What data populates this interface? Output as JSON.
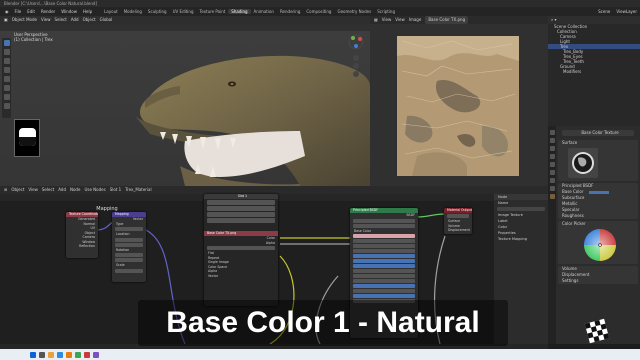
{
  "window": {
    "title": "Blender [C:\\Users\\...\\Base Color Natural.blend]"
  },
  "menubar": {
    "items": [
      "File",
      "Edit",
      "Render",
      "Window",
      "Help"
    ],
    "workspaces": [
      "Layout",
      "Modeling",
      "Sculpting",
      "UV Editing",
      "Texture Paint",
      "Shading",
      "Animation",
      "Rendering",
      "Compositing",
      "Geometry Nodes",
      "Scripting"
    ],
    "active_workspace": "Shading",
    "scene": "Scene",
    "view_layer": "ViewLayer"
  },
  "viewport": {
    "mode": "Object Mode",
    "menus": [
      "View",
      "Select",
      "Add",
      "Object"
    ],
    "transform": "Global",
    "perspective_label": "User Perspective",
    "collection_label": "(1) Collection | Trex"
  },
  "image_editor": {
    "menus": [
      "View",
      "View",
      "Image"
    ],
    "image_name": "Base Color TX.png"
  },
  "outliner": {
    "rows": [
      "Scene Collection",
      "Collection",
      "Camera",
      "Light",
      "Trex",
      "Trex_Body",
      "Trex_Eyes",
      "Trex_Teeth",
      "Ground",
      "Modifiers"
    ],
    "selected_index": 4
  },
  "properties": {
    "header": "Base Color Texture",
    "sections": [
      "Surface",
      "Volume",
      "Displacement",
      "Settings"
    ],
    "rows": [
      "Surface",
      "Principled BSDF",
      "Base Color",
      "Subsurface",
      "Metallic",
      "Specular",
      "Roughness",
      "Color Picker"
    ],
    "accent": "#7a5d3f"
  },
  "shader_editor": {
    "menus": [
      "Object",
      "View",
      "Select",
      "Add",
      "Node"
    ],
    "use_nodes_label": "Use Nodes",
    "slot_label": "Slot 1",
    "material_label": "Trex_Material",
    "frame_label": "Mapping",
    "nodes": {
      "texcoord": {
        "title": "Texture Coordinate",
        "rows": [
          "Generated",
          "Normal",
          "UV",
          "Object",
          "Camera",
          "Window",
          "Reflection"
        ]
      },
      "mapping": {
        "title": "Mapping",
        "rows": [
          "Vector",
          "Type",
          "Point",
          "Location",
          "Rotation",
          "Scale"
        ]
      },
      "image": {
        "title": "Base Color TX.png",
        "rows": [
          "Color",
          "Alpha",
          "Linear",
          "Flat",
          "Repeat",
          "Single Image",
          "Color Space",
          "Alpha",
          "Vector"
        ]
      },
      "bsdf": {
        "title": "Principled BSDF",
        "rows": [
          "BSDF",
          "GGX",
          "Random Walk",
          "Base Color",
          "Subsurface",
          "Subsurface Radius",
          "Subsurface Color",
          "Metallic",
          "Specular",
          "Roughness",
          "Anisotropic",
          "Sheen",
          "Clearcoat",
          "IOR",
          "Transmission",
          "Emission",
          "Alpha",
          "Normal"
        ]
      },
      "output": {
        "title": "Material Output",
        "rows": [
          "All",
          "Surface",
          "Volume",
          "Displacement"
        ]
      }
    },
    "sidebar": {
      "title": "Node",
      "rows": [
        "Name",
        "Image Texture",
        "Label",
        "Color",
        "Properties",
        "Texture Mapping"
      ]
    }
  },
  "caption": {
    "text": "Base Color 1 - Natural"
  },
  "colors": {
    "accent_blue": "#4772b3",
    "node_header_texture": "#8a3b45",
    "node_header_shader": "#2f7a49",
    "node_header_vector": "#4b3d8f",
    "node_header_output": "#7a1f28"
  }
}
